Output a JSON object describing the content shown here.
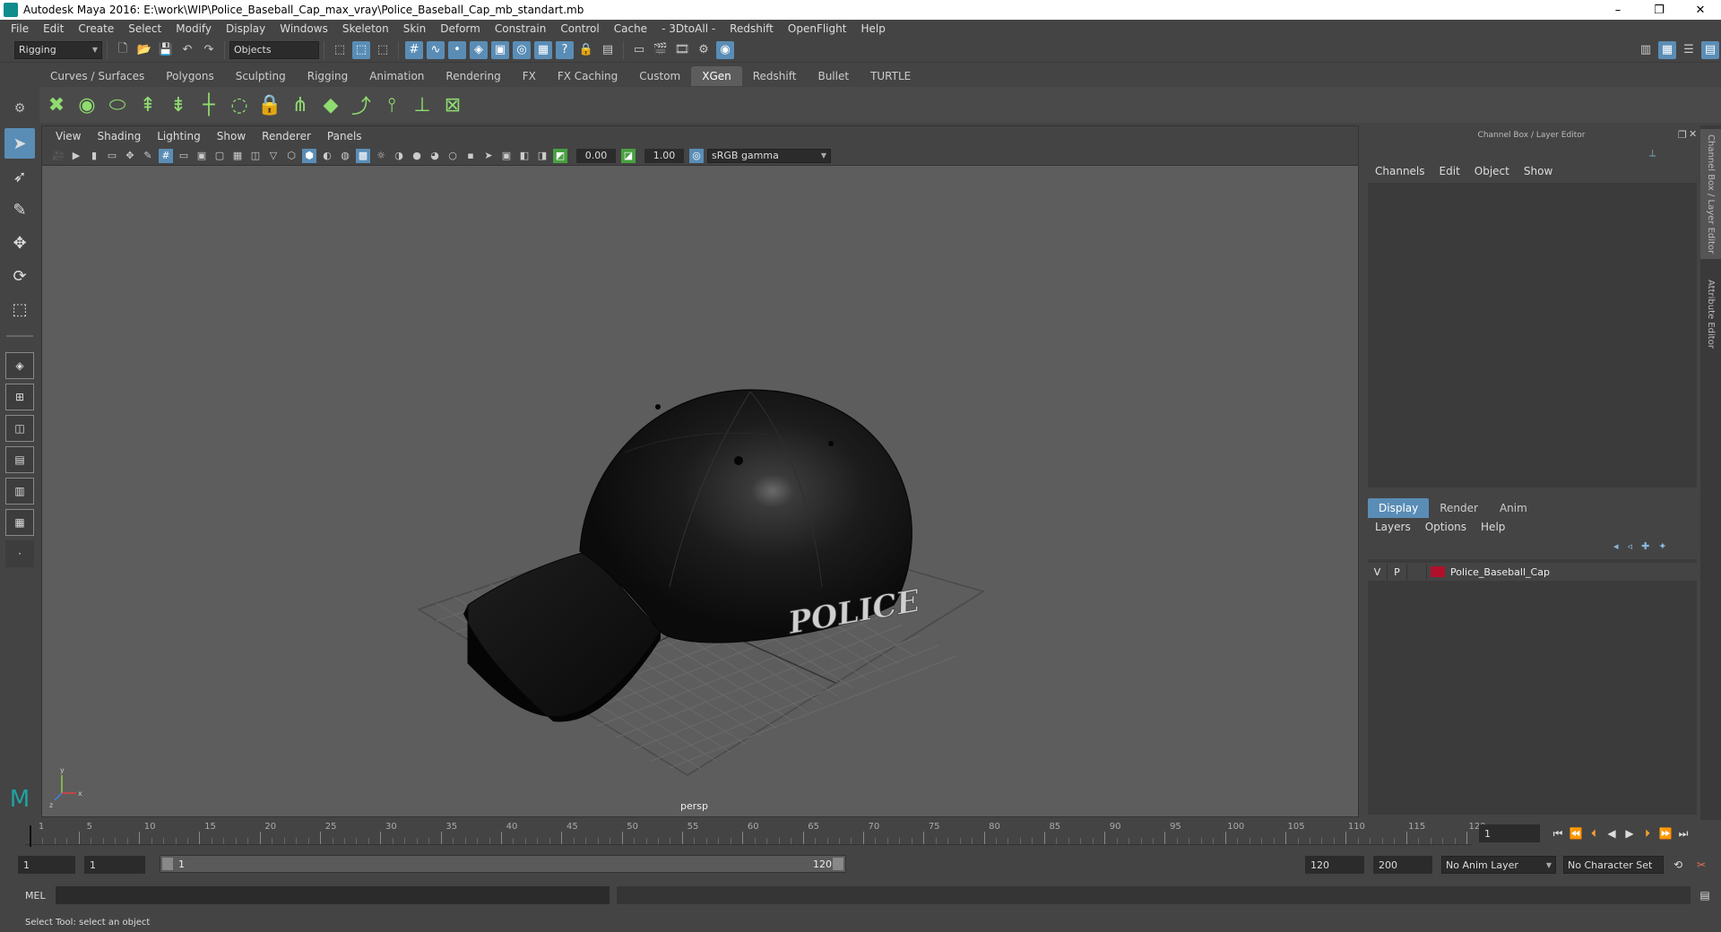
{
  "window": {
    "title": "Autodesk Maya 2016: E:\\work\\WIP\\Police_Baseball_Cap_max_vray\\Police_Baseball_Cap_mb_standart.mb",
    "minimize": "–",
    "restore": "❐",
    "close": "✕"
  },
  "menubar": [
    "File",
    "Edit",
    "Create",
    "Select",
    "Modify",
    "Display",
    "Windows",
    "Skeleton",
    "Skin",
    "Deform",
    "Constrain",
    "Control",
    "Cache",
    "- 3DtoAll -",
    "Redshift",
    "OpenFlight",
    "Help"
  ],
  "statusline": {
    "mode": "Rigging",
    "selection_mode": "Objects"
  },
  "shelf_tabs": [
    "Curves / Surfaces",
    "Polygons",
    "Sculpting",
    "Rigging",
    "Animation",
    "Rendering",
    "FX",
    "FX Caching",
    "Custom",
    "XGen",
    "Redshift",
    "Bullet",
    "TURTLE"
  ],
  "active_shelf_tab": "XGen",
  "panel_menu": [
    "View",
    "Shading",
    "Lighting",
    "Show",
    "Renderer",
    "Panels"
  ],
  "panel_toolbar": {
    "exposure": "0.00",
    "gamma": "1.00",
    "color_space": "sRGB gamma"
  },
  "viewport": {
    "camera": "persp",
    "decal_text": "POLICE",
    "axis_labels": {
      "x": "x",
      "y": "y",
      "z": "z"
    }
  },
  "channel_box": {
    "title": "Channel Box / Layer Editor",
    "menu": [
      "Channels",
      "Edit",
      "Object",
      "Show"
    ]
  },
  "layer_editor": {
    "tabs": [
      "Display",
      "Render",
      "Anim"
    ],
    "active_tab": "Display",
    "menu": [
      "Layers",
      "Options",
      "Help"
    ],
    "layers": [
      {
        "visible": "V",
        "playback": "P",
        "name": "Police_Baseball_Cap",
        "color": "#b20f2a"
      }
    ]
  },
  "side_tabs": [
    "Channel Box / Layer Editor",
    "Attribute Editor"
  ],
  "time_slider": {
    "ticks": [
      1,
      5,
      10,
      15,
      20,
      25,
      30,
      35,
      40,
      45,
      50,
      55,
      60,
      65,
      70,
      75,
      80,
      85,
      90,
      95,
      100,
      105,
      110,
      115,
      120
    ],
    "min": 1,
    "max": 120,
    "current": 1,
    "current_frame_field": "1"
  },
  "range": {
    "start": "1",
    "playback_start": "1",
    "slider_start": "1",
    "slider_end": "120",
    "playback_end": "120",
    "end": "200",
    "anim_layer": "No Anim Layer",
    "character_set": "No Character Set"
  },
  "command_line": {
    "label": "MEL"
  },
  "help_line": "Select Tool: select an object"
}
